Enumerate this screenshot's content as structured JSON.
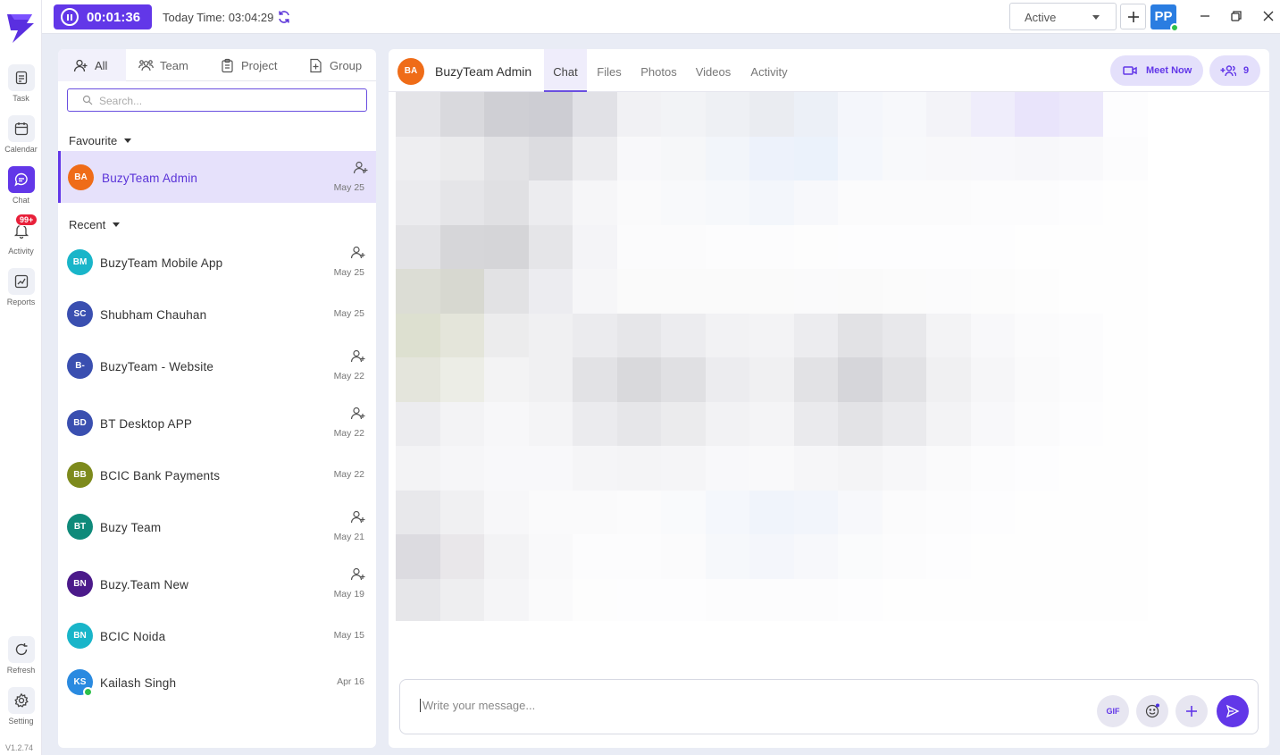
{
  "topbar": {
    "timer": "00:01:36",
    "today_time": "Today Time: 03:04:29",
    "status": "Active",
    "user_initials": "PP"
  },
  "rail": {
    "items": [
      {
        "label": "Task",
        "icon": "task-icon"
      },
      {
        "label": "Calendar",
        "icon": "calendar-icon"
      },
      {
        "label": "Chat",
        "icon": "chat-icon",
        "active": true
      },
      {
        "label": "Activity",
        "icon": "bell-icon",
        "badge": "99+"
      },
      {
        "label": "Reports",
        "icon": "reports-icon"
      }
    ],
    "bottom": [
      {
        "label": "Refresh",
        "icon": "refresh-icon"
      },
      {
        "label": "Setting",
        "icon": "gear-icon"
      }
    ],
    "version": "V1.2.74"
  },
  "panel": {
    "tabs": [
      {
        "label": "All",
        "icon": "user-icon"
      },
      {
        "label": "Team",
        "icon": "team-icon"
      },
      {
        "label": "Project",
        "icon": "clipboard-icon"
      },
      {
        "label": "Group",
        "icon": "add-doc-icon"
      }
    ],
    "search_placeholder": "Search...",
    "favourite_label": "Favourite",
    "recent_label": "Recent",
    "favourites": [
      {
        "initials": "BA",
        "name": "BuzyTeam Admin",
        "date": "May 25",
        "color": "#ef6c18",
        "add": true
      }
    ],
    "recent": [
      {
        "initials": "BM",
        "name": "BuzyTeam Mobile App",
        "date": "May 25",
        "color": "#19b5c9",
        "add": true
      },
      {
        "initials": "SC",
        "name": "Shubham Chauhan",
        "date": "May 25",
        "color": "#3a4fb0",
        "add": false
      },
      {
        "initials": "B-",
        "name": "BuzyTeam - Website",
        "date": "May 22",
        "color": "#3a4fb0",
        "add": true
      },
      {
        "initials": "BD",
        "name": "BT Desktop APP",
        "date": "May 22",
        "color": "#3a4fb0",
        "add": true
      },
      {
        "initials": "BB",
        "name": "BCIC Bank Payments",
        "date": "May 22",
        "color": "#7d8a1c",
        "add": false
      },
      {
        "initials": "BT",
        "name": "Buzy Team",
        "date": "May 21",
        "color": "#0f8a7a",
        "add": true
      },
      {
        "initials": "BN",
        "name": "Buzy.Team New",
        "date": "May 19",
        "color": "#4b1a8a",
        "add": true
      },
      {
        "initials": "BN",
        "name": "BCIC Noida",
        "date": "May 15",
        "color": "#19b5c9",
        "add": false
      },
      {
        "initials": "KS",
        "name": "Kailash Singh",
        "date": "Apr 16",
        "color": "#2a8ae0",
        "add": false,
        "online": true
      }
    ]
  },
  "main": {
    "avatar_initials": "BA",
    "title": "BuzyTeam Admin",
    "tabs": [
      "Chat",
      "Files",
      "Photos",
      "Videos",
      "Activity"
    ],
    "meet_now": "Meet Now",
    "member_count": "9",
    "composer_placeholder": "Write your message...",
    "gif_label": "GIF"
  },
  "colors": {
    "accent": "#6237e8",
    "selected_bg": "#e6e1fb"
  }
}
